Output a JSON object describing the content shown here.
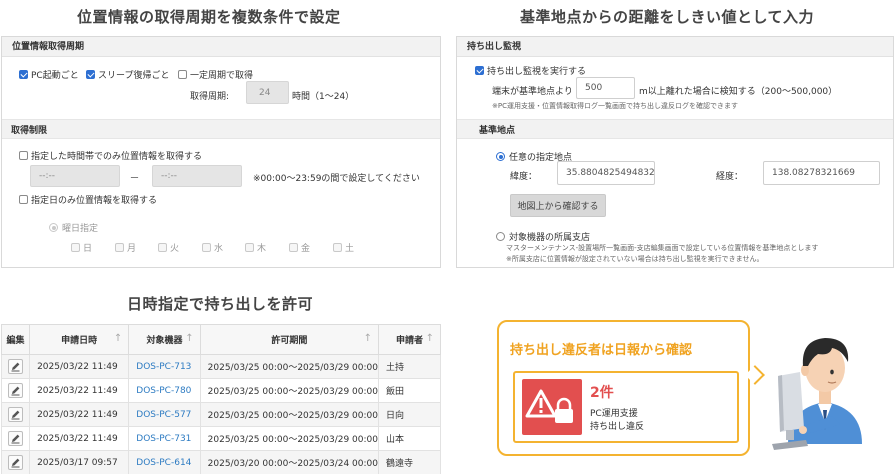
{
  "sections": {
    "top_left_title": "位置情報の取得周期を複数条件で設定",
    "top_right_title": "基準地点からの距離をしきい値として入力",
    "bottom_left_title": "日時指定で持ち出しを許可"
  },
  "acq_panel": {
    "header": "位置情報取得周期",
    "cb_pc_start": "PC起動ごと",
    "cb_sleep": "スリープ復帰ごと",
    "cb_fixed": "一定周期で取得",
    "period_label": "取得周期:",
    "period_value": "24",
    "period_unit": "時間（1〜24）",
    "limit_head": "取得制限",
    "cb_time_only": "指定した時間帯でのみ位置情報を取得する",
    "time_from": "--:--",
    "time_dash": "ー",
    "time_to": "--:--",
    "time_note": "※00:00～23:59の間で設定してください",
    "cb_day_only": "指定日のみ位置情報を取得する",
    "weekday_radio": "曜日指定",
    "days": [
      "日",
      "月",
      "火",
      "水",
      "木",
      "金",
      "土"
    ]
  },
  "carry_panel": {
    "header": "持ち出し監視",
    "cb_enable": "持ち出し監視を実行する",
    "dist_prefix": "端末が基準地点より",
    "dist_value": "500",
    "dist_suffix": "m以上離れた場合に検知する（200～500,000）",
    "dist_note": "※PC運用支援・位置情報取得ログ一覧画面で持ち出し違反ログを確認できます",
    "base_head": "基準地点",
    "radio_custom": "任意の指定地点",
    "lat_label": "緯度：",
    "lat_value": "35.8804825494832",
    "lng_label": "経度：",
    "lng_value": "138.08278321669",
    "map_button": "地図上から確認する",
    "radio_branch": "対象機器の所属支店",
    "branch_note1": "マスターメンテナンス-設置場所一覧画面-支店編集画面で設定している位置情報を基準地点とします",
    "branch_note2": "※所属支店に位置情報が設定されていない場合は持ち出し監視を実行できません。"
  },
  "table": {
    "columns": [
      "編集",
      "申請日時",
      "対象機器",
      "許可期間",
      "申請者"
    ],
    "rows": [
      [
        "2025/03/22 11:49",
        "DOS-PC-713",
        "2025/03/25 00:00～2025/03/29 00:00",
        "土持"
      ],
      [
        "2025/03/22 11:49",
        "DOS-PC-780",
        "2025/03/25 00:00～2025/03/29 00:00",
        "飯田"
      ],
      [
        "2025/03/22 11:49",
        "DOS-PC-577",
        "2025/03/25 00:00～2025/03/29 00:00",
        "日向"
      ],
      [
        "2025/03/22 11:49",
        "DOS-PC-731",
        "2025/03/25 00:00～2025/03/29 00:00",
        "山本"
      ],
      [
        "2025/03/17 09:57",
        "DOS-PC-614",
        "2025/03/20 00:00～2025/03/24 00:00",
        "鶴遠寺"
      ]
    ]
  },
  "callout": {
    "title": "持ち出し違反者は日報から確認",
    "count": "2件",
    "line1": "PC運用支援",
    "line2": "持ち出し違反"
  },
  "colors": {
    "accent": "#f4b330",
    "alert_red": "#e24f4f",
    "link_blue": "#2d7bc2",
    "check_blue": "#2d6fd2"
  }
}
